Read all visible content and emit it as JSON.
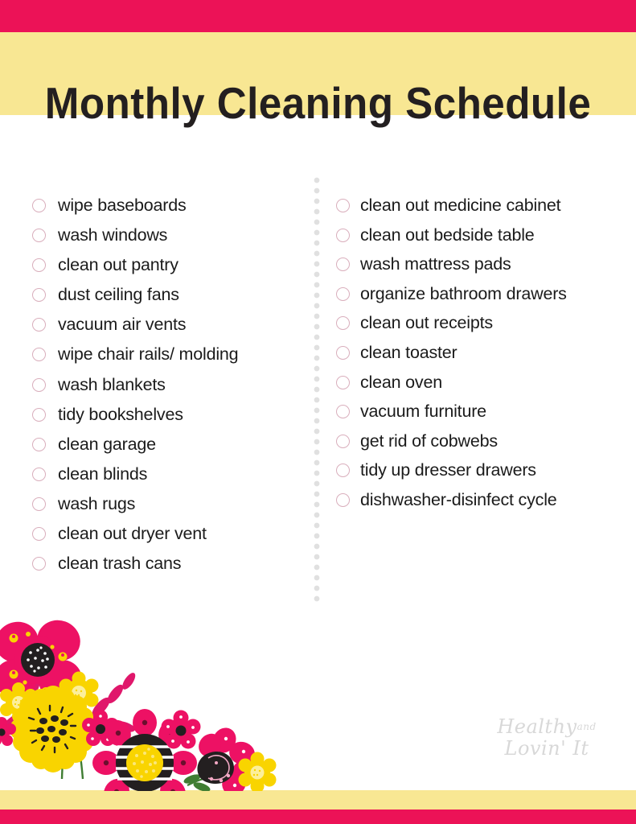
{
  "page": {
    "title": "Monthly Cleaning Schedule",
    "colors": {
      "pink": "#ec1257",
      "yellow": "#f8e793",
      "title_text": "#231f20",
      "item_text": "#1b1b1b",
      "checkbox_border": "#d9aebc",
      "divider_dot": "#e0e0e0",
      "watermark": "#d8d8d8"
    }
  },
  "checklist": {
    "left_column": [
      {
        "label": "wipe baseboards",
        "checked": false
      },
      {
        "label": "wash windows",
        "checked": false
      },
      {
        "label": "clean out pantry",
        "checked": false
      },
      {
        "label": "dust ceiling fans",
        "checked": false
      },
      {
        "label": "vacuum air vents",
        "checked": false
      },
      {
        "label": "wipe chair rails/ molding",
        "checked": false
      },
      {
        "label": "wash blankets",
        "checked": false
      },
      {
        "label": "tidy bookshelves",
        "checked": false
      },
      {
        "label": "clean garage",
        "checked": false
      },
      {
        "label": "clean blinds",
        "checked": false
      },
      {
        "label": "wash rugs",
        "checked": false
      },
      {
        "label": "clean out dryer vent",
        "checked": false
      },
      {
        "label": "clean trash cans",
        "checked": false
      }
    ],
    "right_column": [
      {
        "label": "clean out medicine cabinet",
        "checked": false
      },
      {
        "label": "clean out bedside table",
        "checked": false
      },
      {
        "label": "wash mattress pads",
        "checked": false
      },
      {
        "label": "organize bathroom drawers",
        "checked": false
      },
      {
        "label": "clean out receipts",
        "checked": false
      },
      {
        "label": "clean toaster",
        "checked": false
      },
      {
        "label": "clean oven",
        "checked": false
      },
      {
        "label": "vacuum furniture",
        "checked": false
      },
      {
        "label": "get rid of cobwebs",
        "checked": false
      },
      {
        "label": "tidy up dresser drawers",
        "checked": false
      },
      {
        "label": "dishwasher-disinfect cycle",
        "checked": false
      }
    ]
  },
  "watermark": {
    "line1": "Healthy",
    "line1_small": "and",
    "line2": "Lovin' It"
  }
}
